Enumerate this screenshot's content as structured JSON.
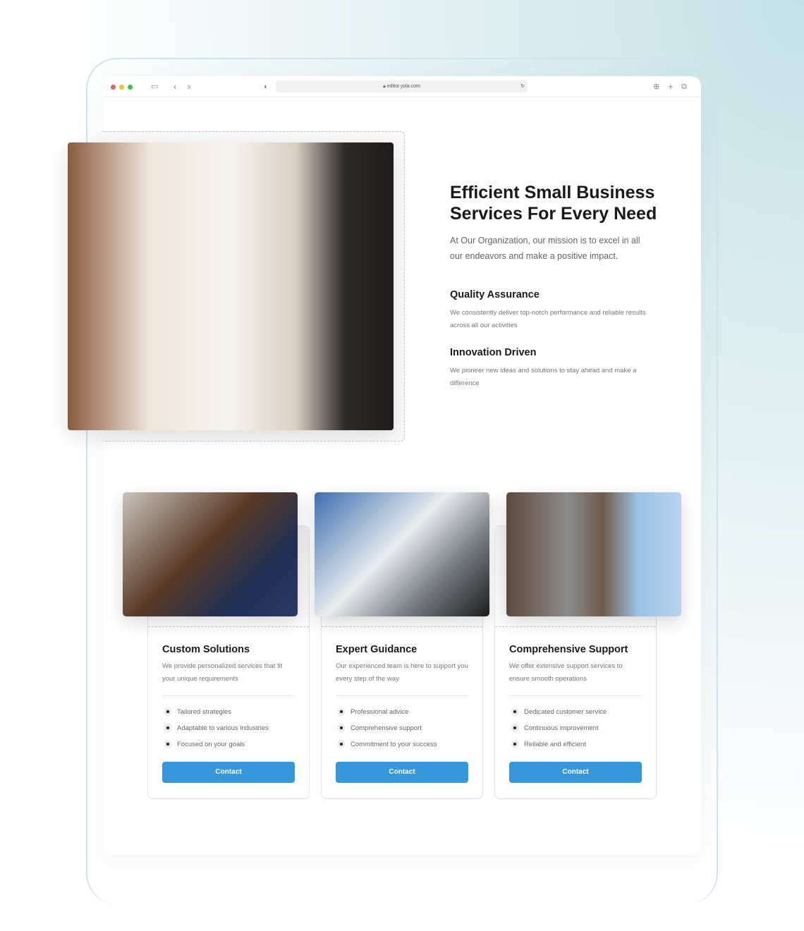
{
  "browser": {
    "url": "editor.yola.com"
  },
  "hero": {
    "title": "Efficient Small Business Services For Every Need",
    "intro": "At Our Organization, our mission is to excel in all our endeavors and make a positive impact.",
    "features": [
      {
        "title": "Quality Assurance",
        "desc": "We consistently deliver top-notch performance and reliable results across all our activities"
      },
      {
        "title": "Innovation Driven",
        "desc": "We pioneer new ideas and solutions to stay ahead and make a difference"
      }
    ]
  },
  "cards": [
    {
      "title": "Custom Solutions",
      "desc": "We provide personalized services that fit your unique requirements",
      "items": [
        "Tailored strategies",
        "Adaptable to various industries",
        "Focused on your goals"
      ],
      "button": "Contact"
    },
    {
      "title": "Expert Guidance",
      "desc": "Our experienced team is here to support you every step of the way",
      "items": [
        "Professional advice",
        "Comprehensive support",
        "Commitment to your success"
      ],
      "button": "Contact"
    },
    {
      "title": "Comprehensive Support",
      "desc": "We offer extensive support services to ensure smooth operations",
      "items": [
        "Dedicated customer service",
        "Continuous improvement",
        "Reliable and efficient"
      ],
      "button": "Contact"
    }
  ],
  "colors": {
    "accent": "#3698db"
  }
}
